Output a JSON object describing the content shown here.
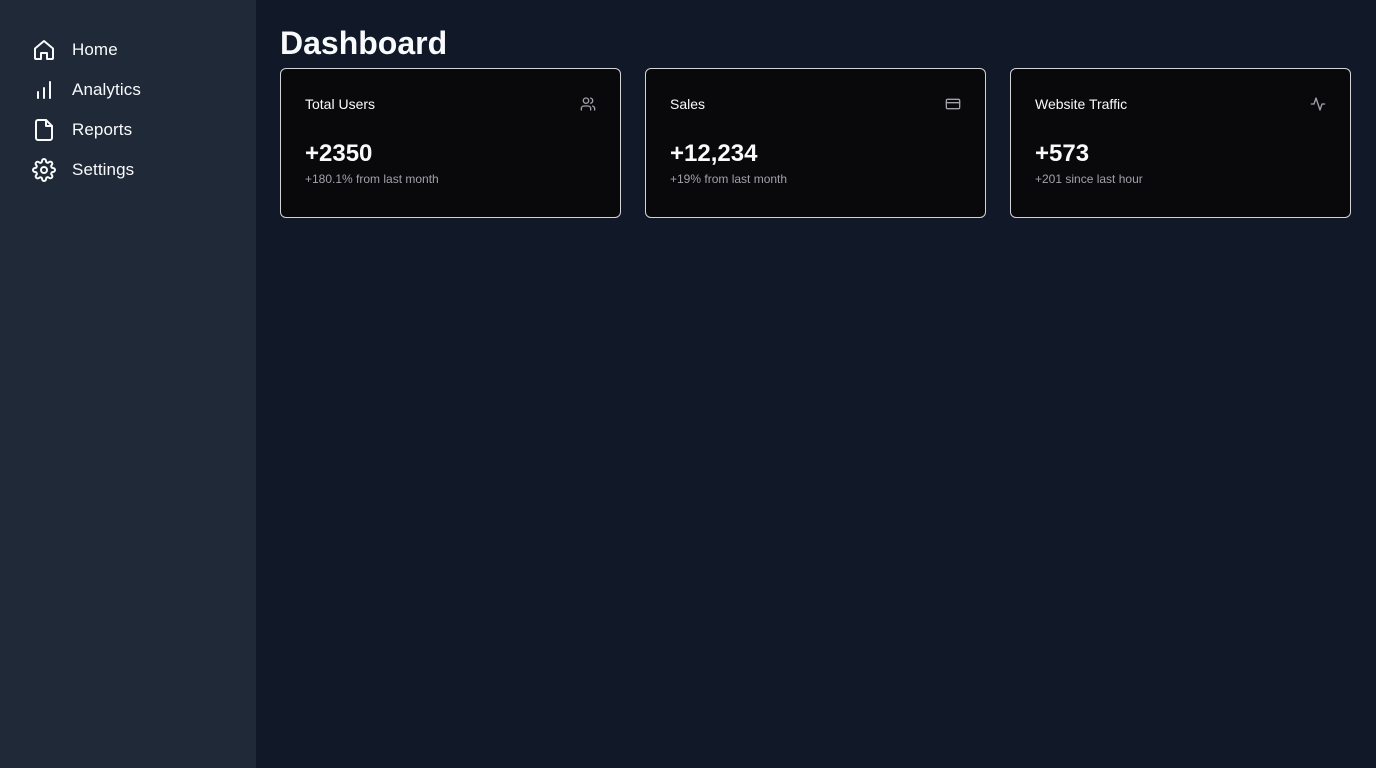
{
  "sidebar": {
    "items": [
      {
        "label": "Home",
        "icon": "home-icon"
      },
      {
        "label": "Analytics",
        "icon": "bar-chart-icon"
      },
      {
        "label": "Reports",
        "icon": "file-icon"
      },
      {
        "label": "Settings",
        "icon": "gear-icon"
      }
    ]
  },
  "main": {
    "title": "Dashboard",
    "cards": [
      {
        "title": "Total Users",
        "value": "+2350",
        "sub": "+180.1% from last month",
        "icon": "users-icon"
      },
      {
        "title": "Sales",
        "value": "+12,234",
        "sub": "+19% from last month",
        "icon": "credit-card-icon"
      },
      {
        "title": "Website Traffic",
        "value": "+573",
        "sub": "+201 since last hour",
        "icon": "activity-icon"
      }
    ]
  },
  "colors": {
    "sidebar_bg": "#1f2937",
    "main_bg": "#111827",
    "card_bg": "#09090b",
    "card_border": "#d4d4d8",
    "muted_text": "#a1a1aa"
  }
}
